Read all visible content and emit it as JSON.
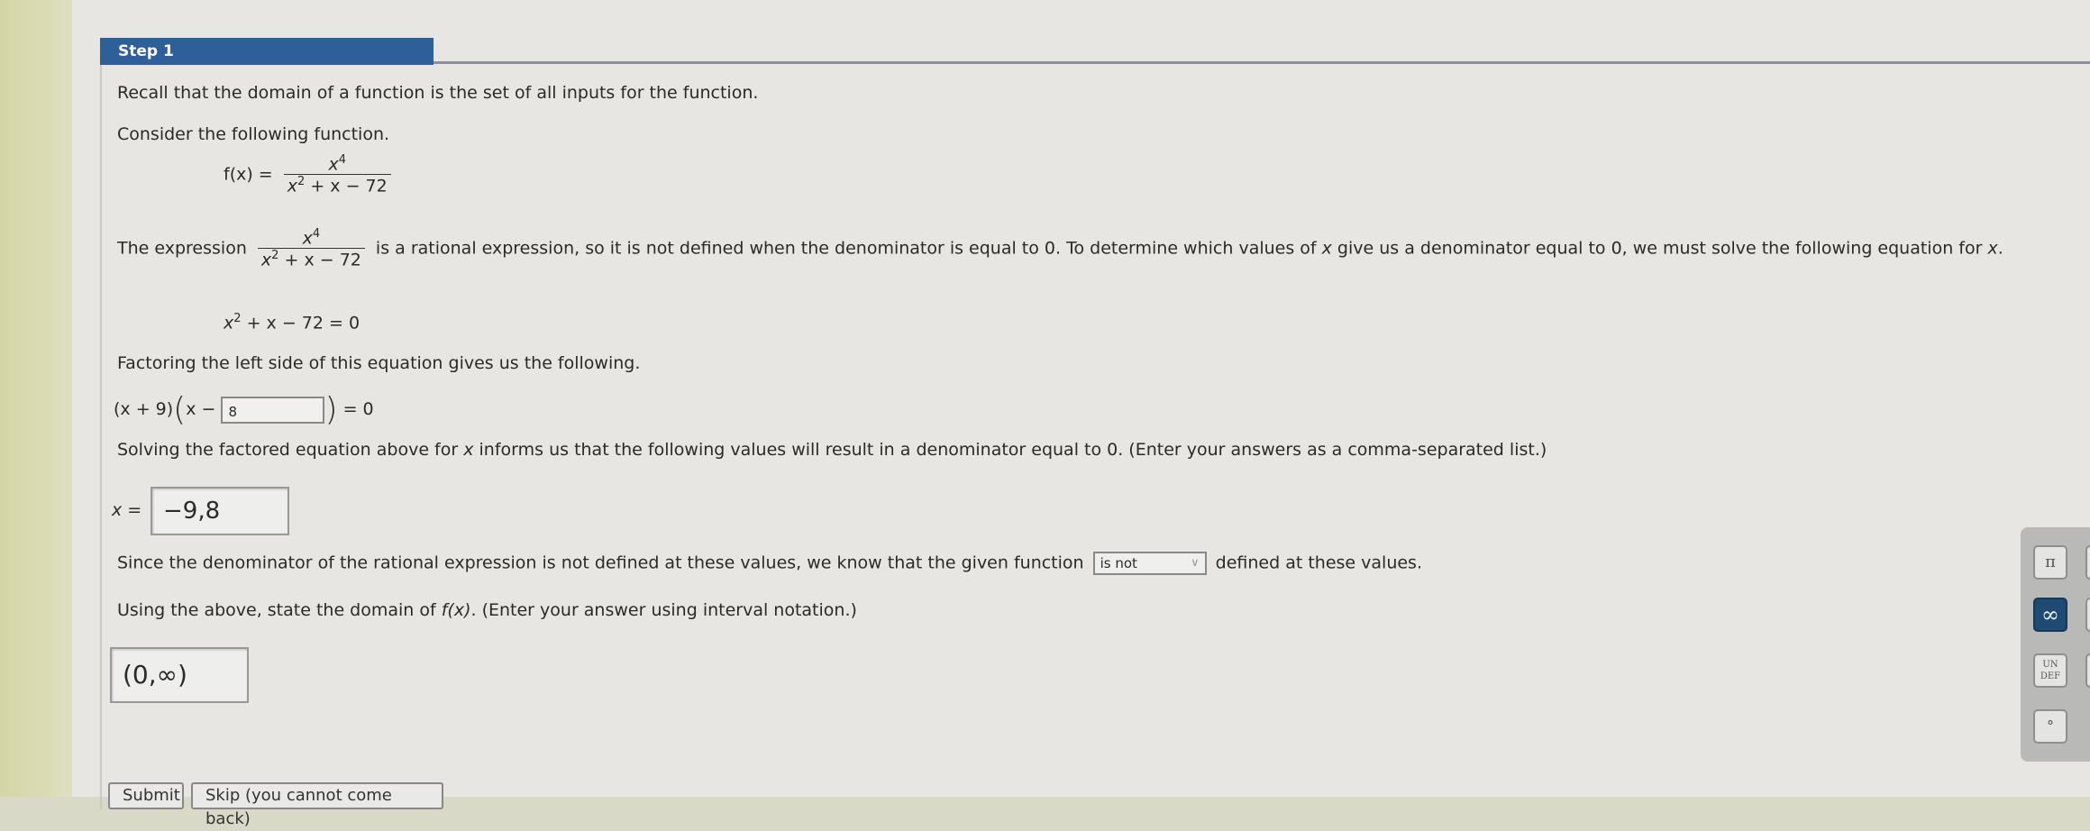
{
  "step": {
    "title": "Step 1"
  },
  "content": {
    "recall": "Recall that the domain of a function is the set of all inputs for the function.",
    "consider": "Consider the following function.",
    "function_lhs": "f(x) =",
    "numerator": "x",
    "numerator_exp": "4",
    "denominator_base": "x",
    "denominator_exp": "2",
    "denominator_rest": " + x − 72",
    "expression_prefix": "The expression",
    "expression_suffix_1": "is a rational expression, so it is not defined when the denominator is equal to 0. To determine which values of ",
    "expression_var": "x",
    "expression_suffix_2": " give us a denominator equal to 0, we must solve the following equation for ",
    "expression_var2": "x",
    "expression_end": ".",
    "equation_rest": " + x − 72 = 0",
    "factoring": "Factoring the left side of this equation gives us the following.",
    "factor_first": "(x + 9)",
    "factor_x_minus": "x −",
    "factor_end": "= 0",
    "solving_1": "Solving the factored equation above for ",
    "solving_var": "x",
    "solving_2": " informs us that the following values will result in a denominator equal to 0. (Enter your answers as a comma-separated list.)",
    "x_eq": "x =",
    "since_1": "Since the denominator of the rational expression is not defined at these values, we know that the given function",
    "since_2": "defined at these values.",
    "using_1": "Using the above, state the domain of ",
    "using_fx": "f(x)",
    "using_2": ". (Enter your answer using interval notation.)"
  },
  "inputs": {
    "factor_answer": "8",
    "x_values": "−9,8",
    "defined_select": "is not",
    "domain_answer": "(0,∞)"
  },
  "palette": {
    "pi": "π",
    "infinity": "∞",
    "undef_1": "UN",
    "undef_2": "DEF",
    "degree": "°"
  },
  "buttons": {
    "submit": "Submit",
    "skip": "Skip (you cannot come back)"
  },
  "colors": {
    "step_header": "#2e5f98",
    "active_palette": "#1f4a72"
  }
}
